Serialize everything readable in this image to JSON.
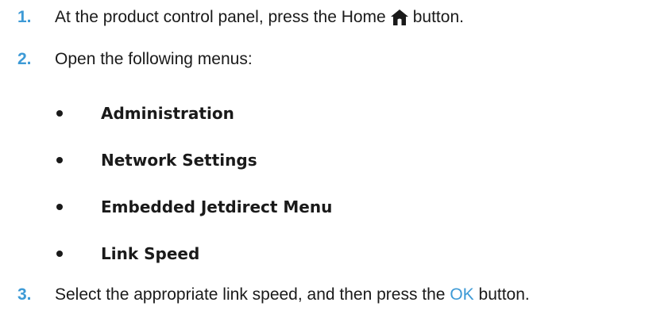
{
  "steps": [
    {
      "number": "1.",
      "text_before": "At the product control panel, press the Home",
      "icon": "home-icon",
      "text_after": "button."
    },
    {
      "number": "2.",
      "text": "Open the following menus:"
    },
    {
      "number": "3.",
      "text_before": "Select the appropriate link speed, and then press the",
      "key": "OK",
      "text_after": "button."
    }
  ],
  "menus": [
    "Administration",
    "Network Settings",
    "Embedded Jetdirect Menu",
    "Link Speed"
  ],
  "colors": {
    "accent": "#3d9ad6",
    "text": "#1a1a1a"
  }
}
